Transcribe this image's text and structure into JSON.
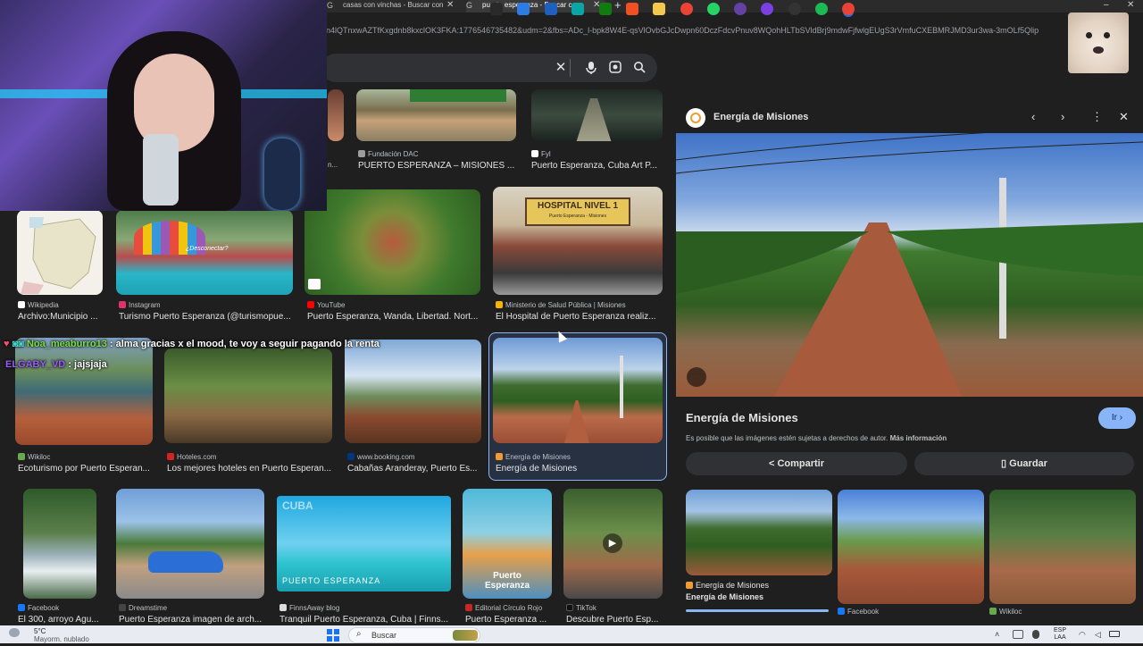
{
  "browser": {
    "tabs": [
      {
        "label": "casas con vinchas - Buscar con",
        "active": false
      },
      {
        "label": "puerto esperanza - Buscar con",
        "active": true
      }
    ],
    "new_tab_symbol": "+",
    "url": "l-n4lQTnxwAZTfKxgdnb8kxclOK3FKA:1776546735482&udm=2&fbs=ADc_l-bpk8W4E-qsVlOvbGJcDwpn60DczFdcvPnuv8WQohHLTbSVldBrj9mdwFjfwlgEUgS3rVmfuCXEBMRJMD3ur3wa-3mOLf5Qlip"
  },
  "results": [
    {
      "source": "Fundación DAC",
      "caption": "PUERTO ESPERANZA – MISIONES ...",
      "fav": "#9e9e9e"
    },
    {
      "source": "Fyl",
      "caption": "Puerto Esperanza, Cuba Art P...",
      "fav": "#ffffff"
    },
    {
      "source": "",
      "caption": "n...",
      "fav": "#1f1f1f"
    },
    {
      "source": "Wikipedia",
      "caption": "Archivo:Municipio ...",
      "fav": "#ffffff"
    },
    {
      "source": "Instagram",
      "caption": "Turismo Puerto Esperanza (@turismopue...",
      "fav": "#e1306c"
    },
    {
      "source": "YouTube",
      "caption": "Puerto Esperanza, Wanda, Libertad. Nort...",
      "fav": "#ff0000"
    },
    {
      "source": "Ministerio de Salud Pública | Misiones",
      "caption": "El Hospital de Puerto Esperanza realiz...",
      "fav": "#f4b400"
    },
    {
      "source": "Wikiloc",
      "caption": "Ecoturismo por Puerto Esperan...",
      "fav": "#6aa84f"
    },
    {
      "source": "Hoteles.com",
      "caption": "Los mejores hoteles en Puerto Esperan...",
      "fav": "#d32323"
    },
    {
      "source": "www.booking.com",
      "caption": "Cabañas Aranderay, Puerto Es...",
      "fav": "#003580"
    },
    {
      "source": "Energía de Misiones",
      "caption": "Energía de Misiones",
      "fav": "#f29b30"
    },
    {
      "source": "Facebook",
      "caption": "El 300, arroyo Agu...",
      "fav": "#1877f2"
    },
    {
      "source": "Dreamstime",
      "caption": "Puerto Esperanza imagen de arch...",
      "fav": "#444444"
    },
    {
      "source": "FinnsAway blog",
      "caption": "Tranquil Puerto Esperanza, Cuba | Finns...",
      "fav": "#dddddd"
    },
    {
      "source": "Editorial Círculo Rojo",
      "caption": "Puerto Esperanza ...",
      "fav": "#c62828"
    },
    {
      "source": "TikTok",
      "caption": "Descubre Puerto Esp...",
      "fav": "#111111"
    }
  ],
  "image_overlays": {
    "pool_sign": "¿Desconectar?",
    "hospital_sign_line1": "HOSPITAL NIVEL 1",
    "hospital_sign_line2": "Puerto Esperanza - Misiones",
    "cuba_label": "CUBA",
    "finns_label": "PUERTO ESPERANZA",
    "book_label": "Puerto Esperanza"
  },
  "panel": {
    "source_name": "Energía de Misiones",
    "title": "Energía de Misiones",
    "visit_label": "Ir",
    "copyright_text": "Es posible que las imágenes estén sujetas a derechos de autor.",
    "more_info": "Más información",
    "share_label": "Compartir",
    "save_label": "Guardar",
    "related": [
      {
        "source": "Energía de Misiones",
        "caption": "Energía de Misiones"
      },
      {
        "source": "Facebook",
        "caption": ""
      },
      {
        "source": "Wikiloc",
        "caption": ""
      }
    ]
  },
  "chat": [
    {
      "user": "Noa_meaburro13",
      "message": ": alma gracias x el mood, te voy a seguir pagando la renta",
      "color": "#7ddc4a"
    },
    {
      "user": "ELGABY_VD",
      "message": ": jajsjaja",
      "color": "#9b5cff"
    }
  ],
  "taskbar": {
    "weather_temp": "5°C",
    "weather_desc": "Mayorm. nublado",
    "search_label": "Buscar",
    "lang": "ESP",
    "lang_sub": "LAA"
  }
}
